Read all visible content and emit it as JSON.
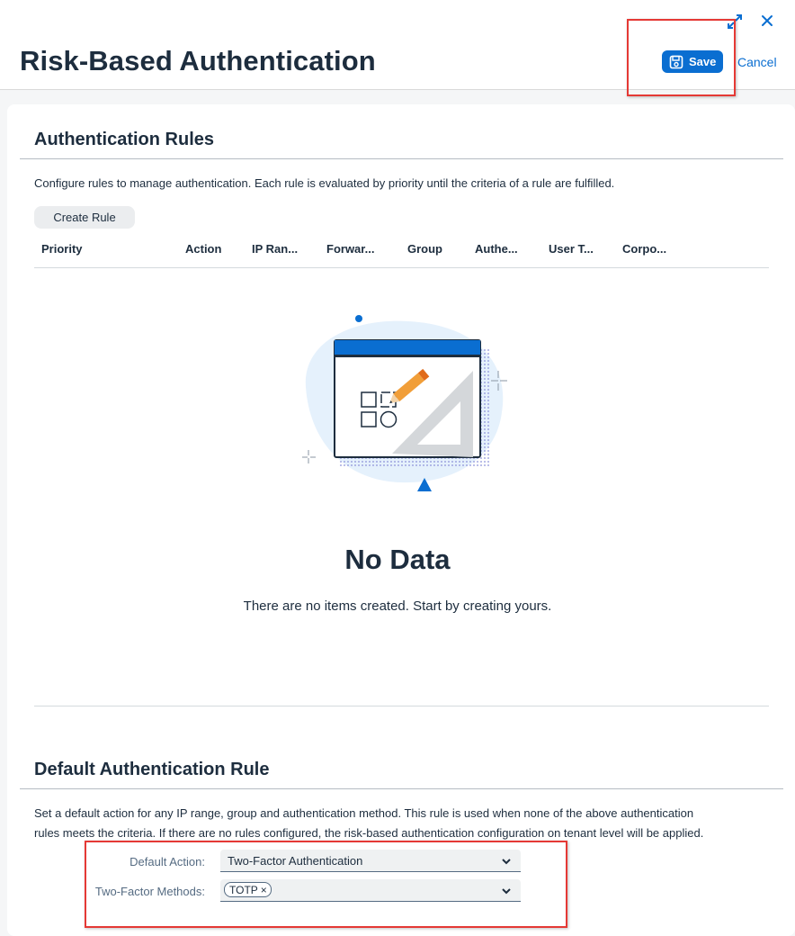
{
  "header": {
    "title": "Risk-Based Authentication",
    "save_label": "Save",
    "cancel_label": "Cancel"
  },
  "auth_rules": {
    "title": "Authentication Rules",
    "description": "Configure rules to manage authentication. Each rule is evaluated by priority until the criteria of a rule are fulfilled.",
    "create_label": "Create Rule",
    "columns": [
      "Priority",
      "Action",
      "IP Ran...",
      "Forwar...",
      "Group",
      "Authe...",
      "User T...",
      "Corpo..."
    ],
    "empty_title": "No Data",
    "empty_text": "There are no items created. Start by creating yours."
  },
  "default_rule": {
    "title": "Default Authentication Rule",
    "description_line1": "Set a default action for any IP range, group and authentication method. This rule is used when none of the above authentication",
    "description_line2": "rules meets the criteria. If there are no rules configured, the risk-based authentication configuration on tenant level will be applied.",
    "default_action_label": "Default Action:",
    "default_action_value": "Two-Factor Authentication",
    "methods_label": "Two-Factor Methods:",
    "methods_tokens": [
      "TOTP"
    ]
  },
  "icons": {
    "fullscreen": "exit-fullscreen-icon",
    "close": "close-icon",
    "save": "save-disk-icon",
    "chevron": "chevron-down-icon"
  },
  "colors": {
    "accent": "#0a6ed1",
    "highlight": "#e53935"
  }
}
